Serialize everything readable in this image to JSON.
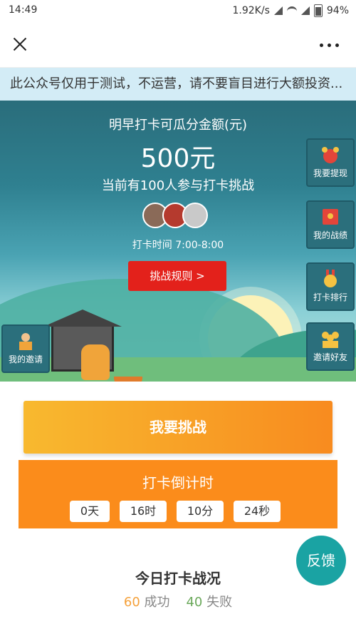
{
  "status_bar": {
    "time": "14:49",
    "network_speed": "1.92K/s",
    "battery": "94%"
  },
  "notice": {
    "text": "此公众号仅用于测试，不运营，请不要盲目进行大额投资..."
  },
  "hero": {
    "title": "明早打卡可瓜分金额(元)",
    "amount": "500元",
    "participants": "当前有100人参与打卡挑战",
    "checkin_time": "打卡时间 7:00-8:00",
    "rules_button": "挑战规则 >"
  },
  "side_buttons": {
    "withdraw": "我要提现",
    "record": "我的战绩",
    "ranking": "打卡排行",
    "invite_friends": "邀请好友",
    "my_invites": "我的邀请"
  },
  "challenge_button": "我要挑战",
  "countdown": {
    "title": "打卡倒计时",
    "days": "0天",
    "hours": "16时",
    "minutes": "10分",
    "seconds": "24秒"
  },
  "feedback": "反馈",
  "today": {
    "title": "今日打卡战况",
    "success_count": "60",
    "success_label": "成功",
    "fail_count": "40",
    "fail_label": "失败"
  },
  "colors": {
    "accent_orange": "#fb8c1b",
    "red": "#e3211b",
    "teal": "#1aa3a3"
  }
}
